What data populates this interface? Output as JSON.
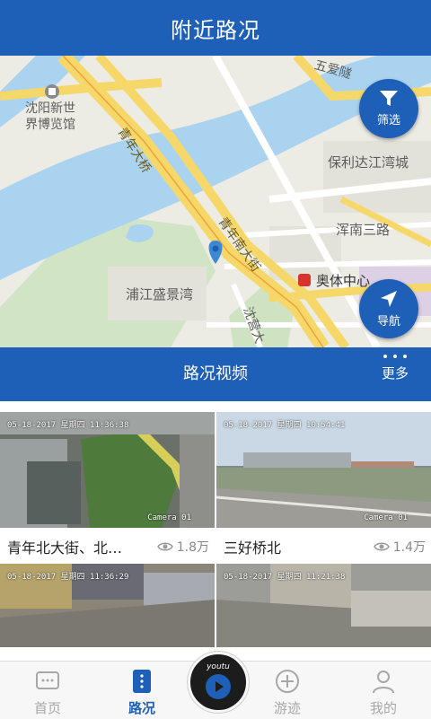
{
  "header": {
    "title": "附近路况"
  },
  "map": {
    "labels": {
      "museum": "沈阳新世\n界博览馆",
      "wuai": "五爱隧",
      "baoli": "保利达江湾城",
      "hunnan3": "浑南三路",
      "qingnian_bridge": "青年大桥",
      "qingnian_south": "青年南大街",
      "aoti": "奥体中心",
      "pujiang": "浦江盛景湾",
      "shenying": "沈营大"
    },
    "filter_button": {
      "label": "筛选",
      "icon": "funnel-icon"
    },
    "nav_button": {
      "label": "导航",
      "icon": "navigate-arrow-icon"
    }
  },
  "videos_section": {
    "title": "路况视频",
    "more_label": "更多"
  },
  "videos": [
    {
      "name": "青年北大街、北…",
      "views": "1.8万",
      "osd": "05-18-2017  星期四  11:36:38",
      "camera": "Camera 01"
    },
    {
      "name": "三好桥北",
      "views": "1.4万",
      "osd": "05-18-2017  星期四  10:54:41",
      "camera": "Camera 01"
    },
    {
      "osd": "05-18-2017  星期四  11:36:29"
    },
    {
      "osd": "05-18-2017  星期四  11:21:38"
    }
  ],
  "tabbar": {
    "items": [
      {
        "label": "首页",
        "icon": "message-box-icon"
      },
      {
        "label": "路况",
        "icon": "list-dots-icon"
      },
      {
        "label": "游迹",
        "icon": "compass-plus-icon"
      },
      {
        "label": "我的",
        "icon": "person-icon"
      }
    ],
    "center": {
      "brand": "youtu",
      "icon": "play-icon"
    }
  },
  "colors": {
    "primary": "#1e5fb8",
    "inactive": "#a7a7a7",
    "road_yellow": "#f6d86a",
    "water": "#aad3f0"
  }
}
